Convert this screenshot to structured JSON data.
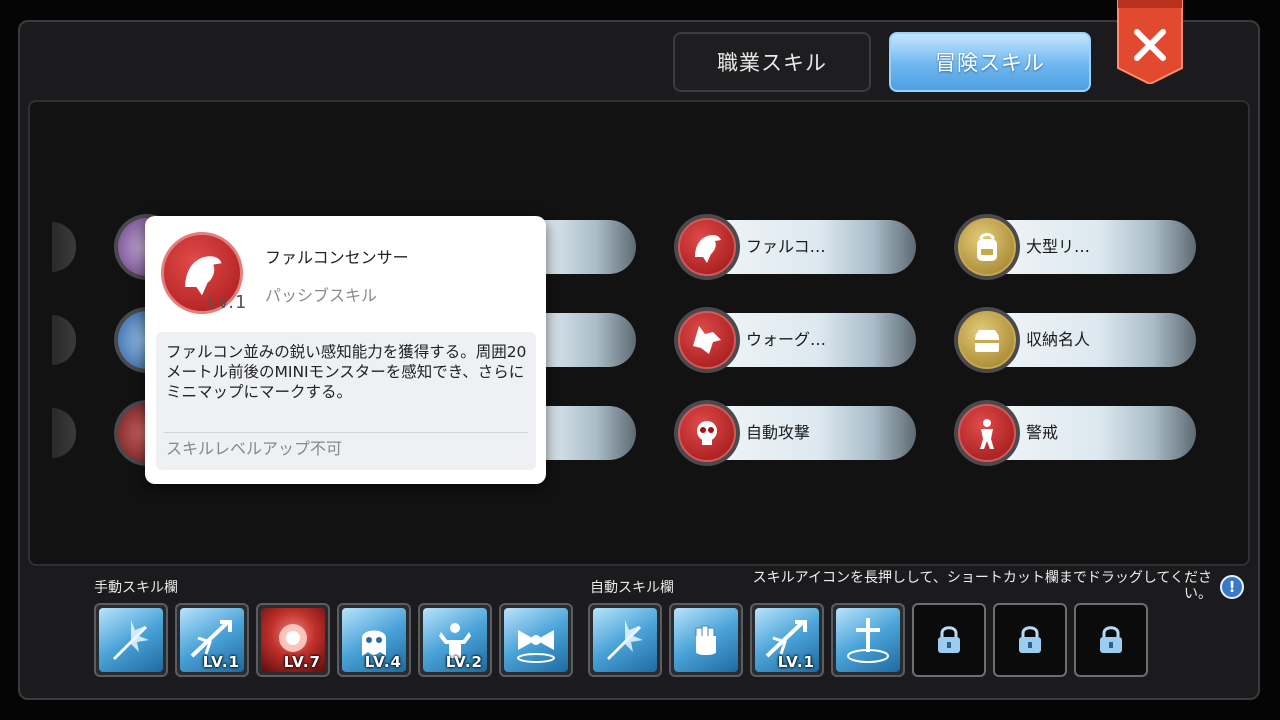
{
  "tabs": {
    "job": "職業スキル",
    "adventure": "冒険スキル"
  },
  "close": {
    "icon": "close-x-icon",
    "color": "#e8452f"
  },
  "skills": [
    {
      "label": "ファルコ…",
      "icon": "falcon-icon"
    },
    {
      "label": "大型リ…",
      "icon": "backpack-icon"
    },
    {
      "label": "ウォーグ…",
      "icon": "wolf-icon"
    },
    {
      "label": "収納名人",
      "icon": "storage-chest-icon"
    },
    {
      "label": "自動攻撃",
      "icon": "skull-icon"
    },
    {
      "label": "警戒",
      "icon": "alert-person-icon"
    }
  ],
  "tooltip": {
    "name": "ファルコンセンサー",
    "level": "Lv.1",
    "type": "パッシブスキル",
    "description": "ファルコン並みの鋭い感知能力を獲得する。周囲20メートル前後のMINIモンスターを感知でき、さらにミニマップにマークする。",
    "note": "スキルレベルアップ不可"
  },
  "manual_bar": {
    "label": "手動スキル欄",
    "slots": [
      {
        "icon": "sword-strike-icon",
        "level": ""
      },
      {
        "icon": "arrow-strike-icon",
        "level": "LV.1"
      },
      {
        "icon": "explosion-icon",
        "level": "LV.7"
      },
      {
        "icon": "ghost-burst-icon",
        "level": "LV.4"
      },
      {
        "icon": "muscle-figure-icon",
        "level": "LV.2"
      },
      {
        "icon": "ribbon-icon",
        "level": ""
      }
    ]
  },
  "auto_bar": {
    "label": "自動スキル欄",
    "slots": [
      {
        "icon": "sword-strike-icon",
        "level": ""
      },
      {
        "icon": "fist-icon",
        "level": ""
      },
      {
        "icon": "arrow-strike-icon",
        "level": "LV.1"
      },
      {
        "icon": "holy-sword-icon",
        "level": ""
      },
      {
        "icon": "lock-icon",
        "level": ""
      },
      {
        "icon": "lock-icon",
        "level": ""
      },
      {
        "icon": "lock-icon",
        "level": ""
      }
    ]
  },
  "hint": "スキルアイコンを長押しして、ショートカット欄までドラッグしてください。",
  "info_icon": "!"
}
